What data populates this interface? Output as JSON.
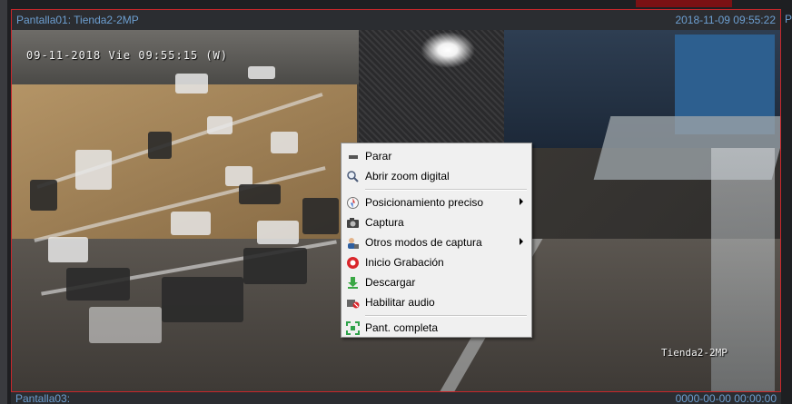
{
  "pane1": {
    "title": "Pantalla01:  Tienda2-2MP",
    "timestamp": "2018-11-09 09:55:22",
    "osd_datetime": "09-11-2018 Vie 09:55:15 (W)",
    "osd_camera_name": "Tienda2-2MP",
    "right_edge_label": "P"
  },
  "pane2": {
    "title": "Pantalla03:",
    "timestamp": "0000-00-00 00:00:00"
  },
  "context_menu": {
    "items": [
      {
        "label": "Parar",
        "icon": "stop-icon",
        "submenu": false
      },
      {
        "label": "Abrir zoom digital",
        "icon": "zoom-icon",
        "submenu": false
      },
      {
        "label": "Posicionamiento preciso",
        "icon": "ptz-icon",
        "submenu": true
      },
      {
        "label": "Captura",
        "icon": "camera-icon",
        "submenu": false
      },
      {
        "label": "Otros modos de captura",
        "icon": "capture-modes-icon",
        "submenu": true
      },
      {
        "label": "Inicio Grabación",
        "icon": "record-icon",
        "submenu": false
      },
      {
        "label": "Descargar",
        "icon": "download-icon",
        "submenu": false
      },
      {
        "label": "Habilitar audio",
        "icon": "audio-icon",
        "submenu": false
      },
      {
        "label": "Pant. completa",
        "icon": "fullscreen-icon",
        "submenu": false
      }
    ]
  },
  "colors": {
    "header_text": "#6d9fd1",
    "selected_border": "#c8272b",
    "record_red": "#d9262b"
  }
}
